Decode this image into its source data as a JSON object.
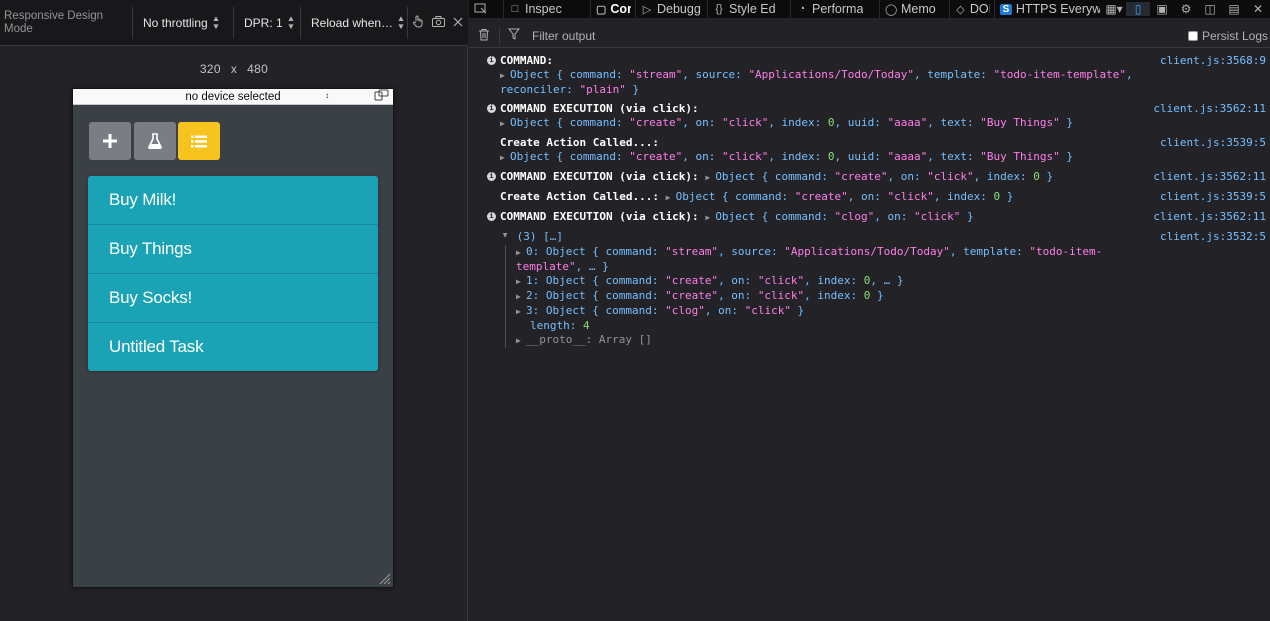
{
  "rdm": {
    "title": "Responsive Design Mode",
    "throttling": "No throttling",
    "dpr": "DPR: 1",
    "reload": "Reload when…",
    "width": "320",
    "x": "x",
    "height": "480",
    "device": "no device selected"
  },
  "app": {
    "todos": [
      "Buy Milk!",
      "Buy Things",
      "Buy Socks!",
      "Untitled Task"
    ]
  },
  "devtools": {
    "tabs": [
      {
        "label": "Inspec",
        "icon": "inspector-icon"
      },
      {
        "label": "Conso",
        "icon": "console-icon",
        "active": true
      },
      {
        "label": "Debugg",
        "icon": "debugger-icon"
      },
      {
        "label": "Style Ed",
        "icon": "style-editor-icon"
      },
      {
        "label": "Performa",
        "icon": "performance-icon"
      },
      {
        "label": "Memo",
        "icon": "memory-icon"
      },
      {
        "label": "DOI",
        "icon": "dom-icon"
      },
      {
        "label": "HTTPS Everyw",
        "icon": "https-everywhere-icon"
      }
    ],
    "filter_placeholder": "Filter output",
    "persist_logs": "Persist Logs"
  },
  "console": {
    "messages": [
      {
        "label": "COMMAND:",
        "source": "client.js:3568:9"
      },
      {
        "label": "COMMAND EXECUTION (via click):",
        "source": "client.js:3562:11"
      },
      {
        "label": "Create Action Called...:",
        "source": "client.js:3539:5"
      },
      {
        "label": "COMMAND EXECUTION (via click):",
        "source": "client.js:3562:11"
      },
      {
        "label": "Create Action Called...:",
        "source": "client.js:3539:5"
      },
      {
        "label": "COMMAND EXECUTION (via click):",
        "source": "client.js:3562:11"
      },
      {
        "label": "(3) […]",
        "source": "client.js:3532:5"
      }
    ],
    "array_length": "4",
    "proto": "__proto__: Array []"
  },
  "colors": {
    "todo_bg": "#1aa3b5",
    "active_button": "#f7c31e",
    "console_key": "#75bfff",
    "console_string": "#ff7de9",
    "console_number": "#86de74"
  }
}
